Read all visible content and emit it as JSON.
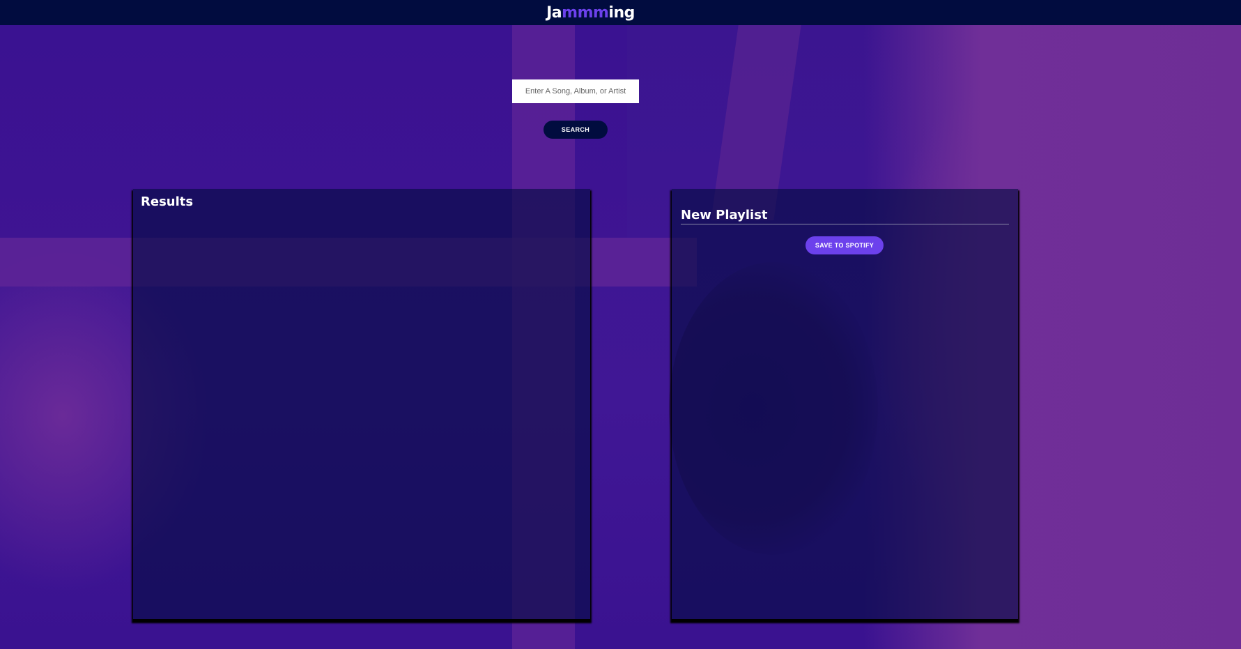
{
  "header": {
    "logo_start": "Ja",
    "logo_accent": "mmm",
    "logo_end": "ing"
  },
  "search": {
    "placeholder": "Enter A Song, Album, or Artist",
    "value": "",
    "button_label": "SEARCH"
  },
  "results": {
    "title": "Results",
    "tracks": []
  },
  "playlist": {
    "name": "New Playlist",
    "tracks": [],
    "save_label": "SAVE TO SPOTIFY"
  },
  "colors": {
    "header_bg": "#010c3f",
    "accent": "#6c41ec",
    "panel_bg": "rgba(1,12,63,0.6)"
  }
}
